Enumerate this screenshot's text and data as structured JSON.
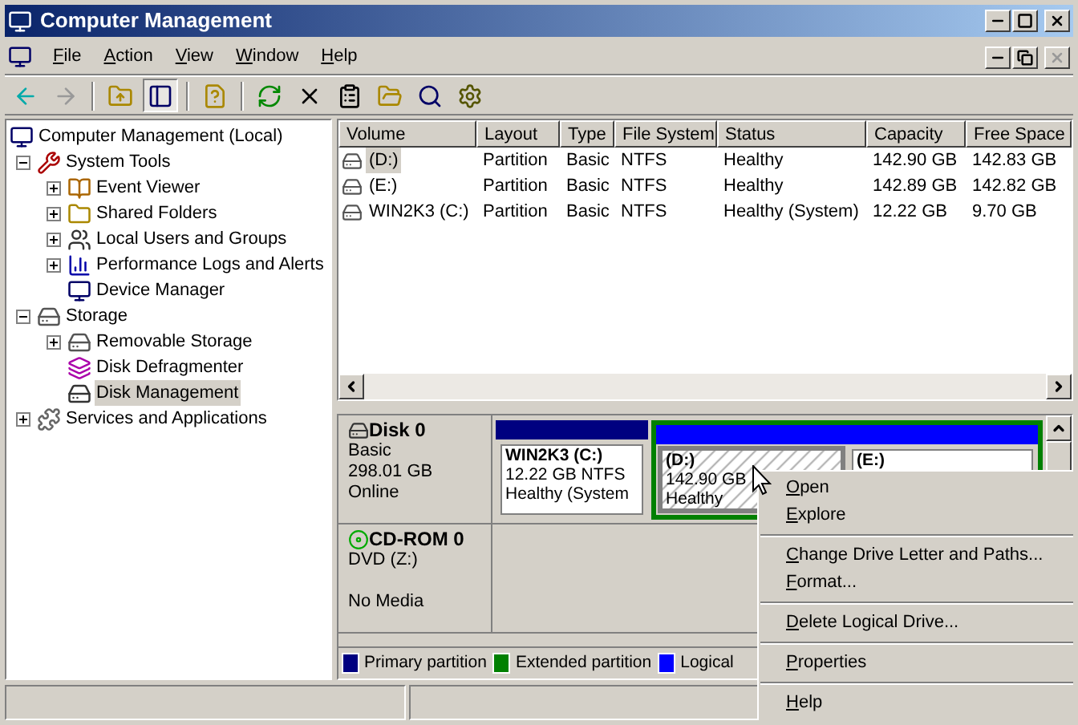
{
  "window": {
    "title": "Computer Management"
  },
  "menu": [
    {
      "label": "File"
    },
    {
      "label": "Action"
    },
    {
      "label": "View"
    },
    {
      "label": "Window"
    },
    {
      "label": "Help"
    }
  ],
  "toolbar": [
    {
      "kind": "back",
      "disabled": false,
      "pressed": false
    },
    {
      "kind": "forward",
      "disabled": true,
      "pressed": false
    },
    {
      "kind": "separator"
    },
    {
      "kind": "up",
      "disabled": false,
      "pressed": false
    },
    {
      "kind": "tree",
      "disabled": false,
      "pressed": true
    },
    {
      "kind": "separator"
    },
    {
      "kind": "help",
      "disabled": false,
      "pressed": false
    },
    {
      "kind": "separator"
    },
    {
      "kind": "refresh",
      "disabled": false,
      "pressed": false
    },
    {
      "kind": "delete",
      "disabled": false,
      "pressed": false
    },
    {
      "kind": "properties",
      "disabled": false,
      "pressed": false
    },
    {
      "kind": "open",
      "disabled": false,
      "pressed": false
    },
    {
      "kind": "search",
      "disabled": false,
      "pressed": false
    },
    {
      "kind": "settings",
      "disabled": false,
      "pressed": false
    }
  ],
  "tree": [
    {
      "label": "Computer Management (Local)",
      "kind": "computer",
      "selected": false,
      "children": [
        {
          "label": "System Tools",
          "kind": "tools",
          "selected": false,
          "expanded": true,
          "children": [
            {
              "label": "Event Viewer",
              "kind": "log",
              "selected": false,
              "expanded": false
            },
            {
              "label": "Shared Folders",
              "kind": "folder",
              "selected": false,
              "expanded": false
            },
            {
              "label": "Local Users and Groups",
              "kind": "users",
              "selected": false,
              "expanded": false
            },
            {
              "label": "Performance Logs and Alerts",
              "kind": "chart",
              "selected": false,
              "expanded": false
            },
            {
              "label": "Device Manager",
              "kind": "computer",
              "selected": false
            }
          ]
        },
        {
          "label": "Storage",
          "kind": "storage",
          "selected": false,
          "expanded": true,
          "children": [
            {
              "label": "Removable Storage",
              "kind": "storage",
              "selected": false,
              "expanded": false
            },
            {
              "label": "Disk Defragmenter",
              "kind": "defrag",
              "selected": false
            },
            {
              "label": "Disk Management",
              "kind": "disk",
              "selected": true
            }
          ]
        },
        {
          "label": "Services and Applications",
          "kind": "services",
          "selected": false,
          "expanded": false
        }
      ]
    }
  ],
  "table": {
    "columns": [
      "Volume",
      "Layout",
      "Type",
      "File System",
      "Status",
      "Capacity",
      "Free Space"
    ],
    "rows": [
      {
        "selected": true,
        "cells": [
          "(D:)",
          "Partition",
          "Basic",
          "NTFS",
          "Healthy",
          "142.90 GB",
          "142.83 GB"
        ]
      },
      {
        "selected": false,
        "cells": [
          "(E:)",
          "Partition",
          "Basic",
          "NTFS",
          "Healthy",
          "142.89 GB",
          "142.82 GB"
        ]
      },
      {
        "selected": false,
        "cells": [
          "WIN2K3 (C:)",
          "Partition",
          "Basic",
          "NTFS",
          "Healthy (System)",
          "12.22 GB",
          "9.70 GB"
        ]
      }
    ]
  },
  "disks": [
    {
      "kind": "disk",
      "name": "Disk 0",
      "lines": [
        "Basic",
        "298.01 GB"
      ],
      "status": "Online",
      "partitions": [
        {
          "kind": "primary",
          "name": "WIN2K3  (C:)",
          "size": "12.22 GB NTFS",
          "status": "Healthy (System",
          "selected": false
        },
        {
          "kind": "extended",
          "children": [
            {
              "kind": "logical",
              "name": "(D:)",
              "size": "142.90 GB",
              "status": "Healthy",
              "selected": true
            },
            {
              "kind": "logical",
              "name": "(E:)",
              "selected": false
            }
          ]
        }
      ]
    },
    {
      "kind": "cdrom",
      "name": "CD-ROM 0",
      "lines": [
        "DVD (Z:)"
      ],
      "status": "No Media"
    }
  ],
  "legend": [
    {
      "label": "Primary partition",
      "color": "#000080"
    },
    {
      "label": "Extended partition",
      "color": "#008000"
    },
    {
      "label": "Logical",
      "color": "#0000ff"
    }
  ],
  "context_menu": [
    {
      "kind": "item",
      "label": "Open"
    },
    {
      "kind": "item",
      "label": "Explore"
    },
    {
      "kind": "separator"
    },
    {
      "kind": "item",
      "label": "Change Drive Letter and Paths..."
    },
    {
      "kind": "item",
      "label": "Format..."
    },
    {
      "kind": "separator"
    },
    {
      "kind": "item",
      "label": "Delete Logical Drive..."
    },
    {
      "kind": "separator"
    },
    {
      "kind": "item",
      "label": "Properties"
    },
    {
      "kind": "separator"
    },
    {
      "kind": "item",
      "label": "Help"
    }
  ]
}
